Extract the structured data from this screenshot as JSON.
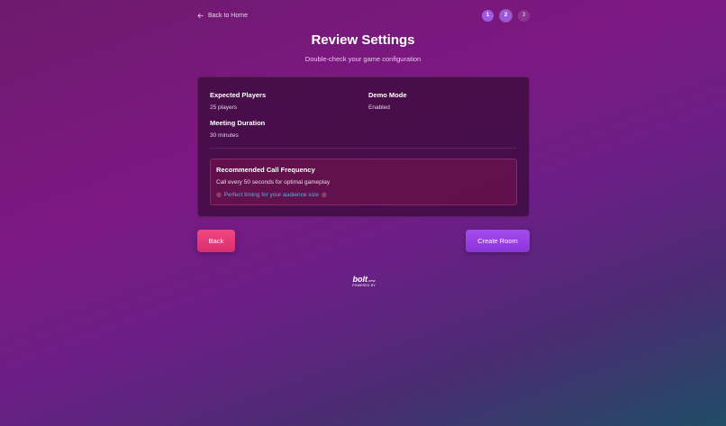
{
  "nav": {
    "back_home_label": "Back to Home",
    "steps": [
      "1",
      "2",
      "3"
    ]
  },
  "header": {
    "title": "Review Settings",
    "subtitle": "Double-check your game configuration"
  },
  "summary": {
    "expected_players_label": "Expected Players",
    "expected_players_value": "25 players",
    "demo_mode_label": "Demo Mode",
    "demo_mode_value": "Enabled",
    "meeting_duration_label": "Meeting Duration",
    "meeting_duration_value": "30 minutes"
  },
  "recommendation": {
    "title": "Recommended Call Frequency",
    "description": "Call every 50 seconds for optimal gameplay",
    "note": "Perfect timing for your audience size",
    "icon": "target-icon"
  },
  "actions": {
    "back_label": "Back",
    "create_label": "Create Room"
  },
  "badge": {
    "wordmark": "bolt",
    "wordmark_suffix": ".new",
    "caption": "POWERED BY"
  },
  "colors": {
    "back_button": "#e83a77",
    "create_button": "#9a40e6",
    "note_text": "#4fb6e6"
  }
}
